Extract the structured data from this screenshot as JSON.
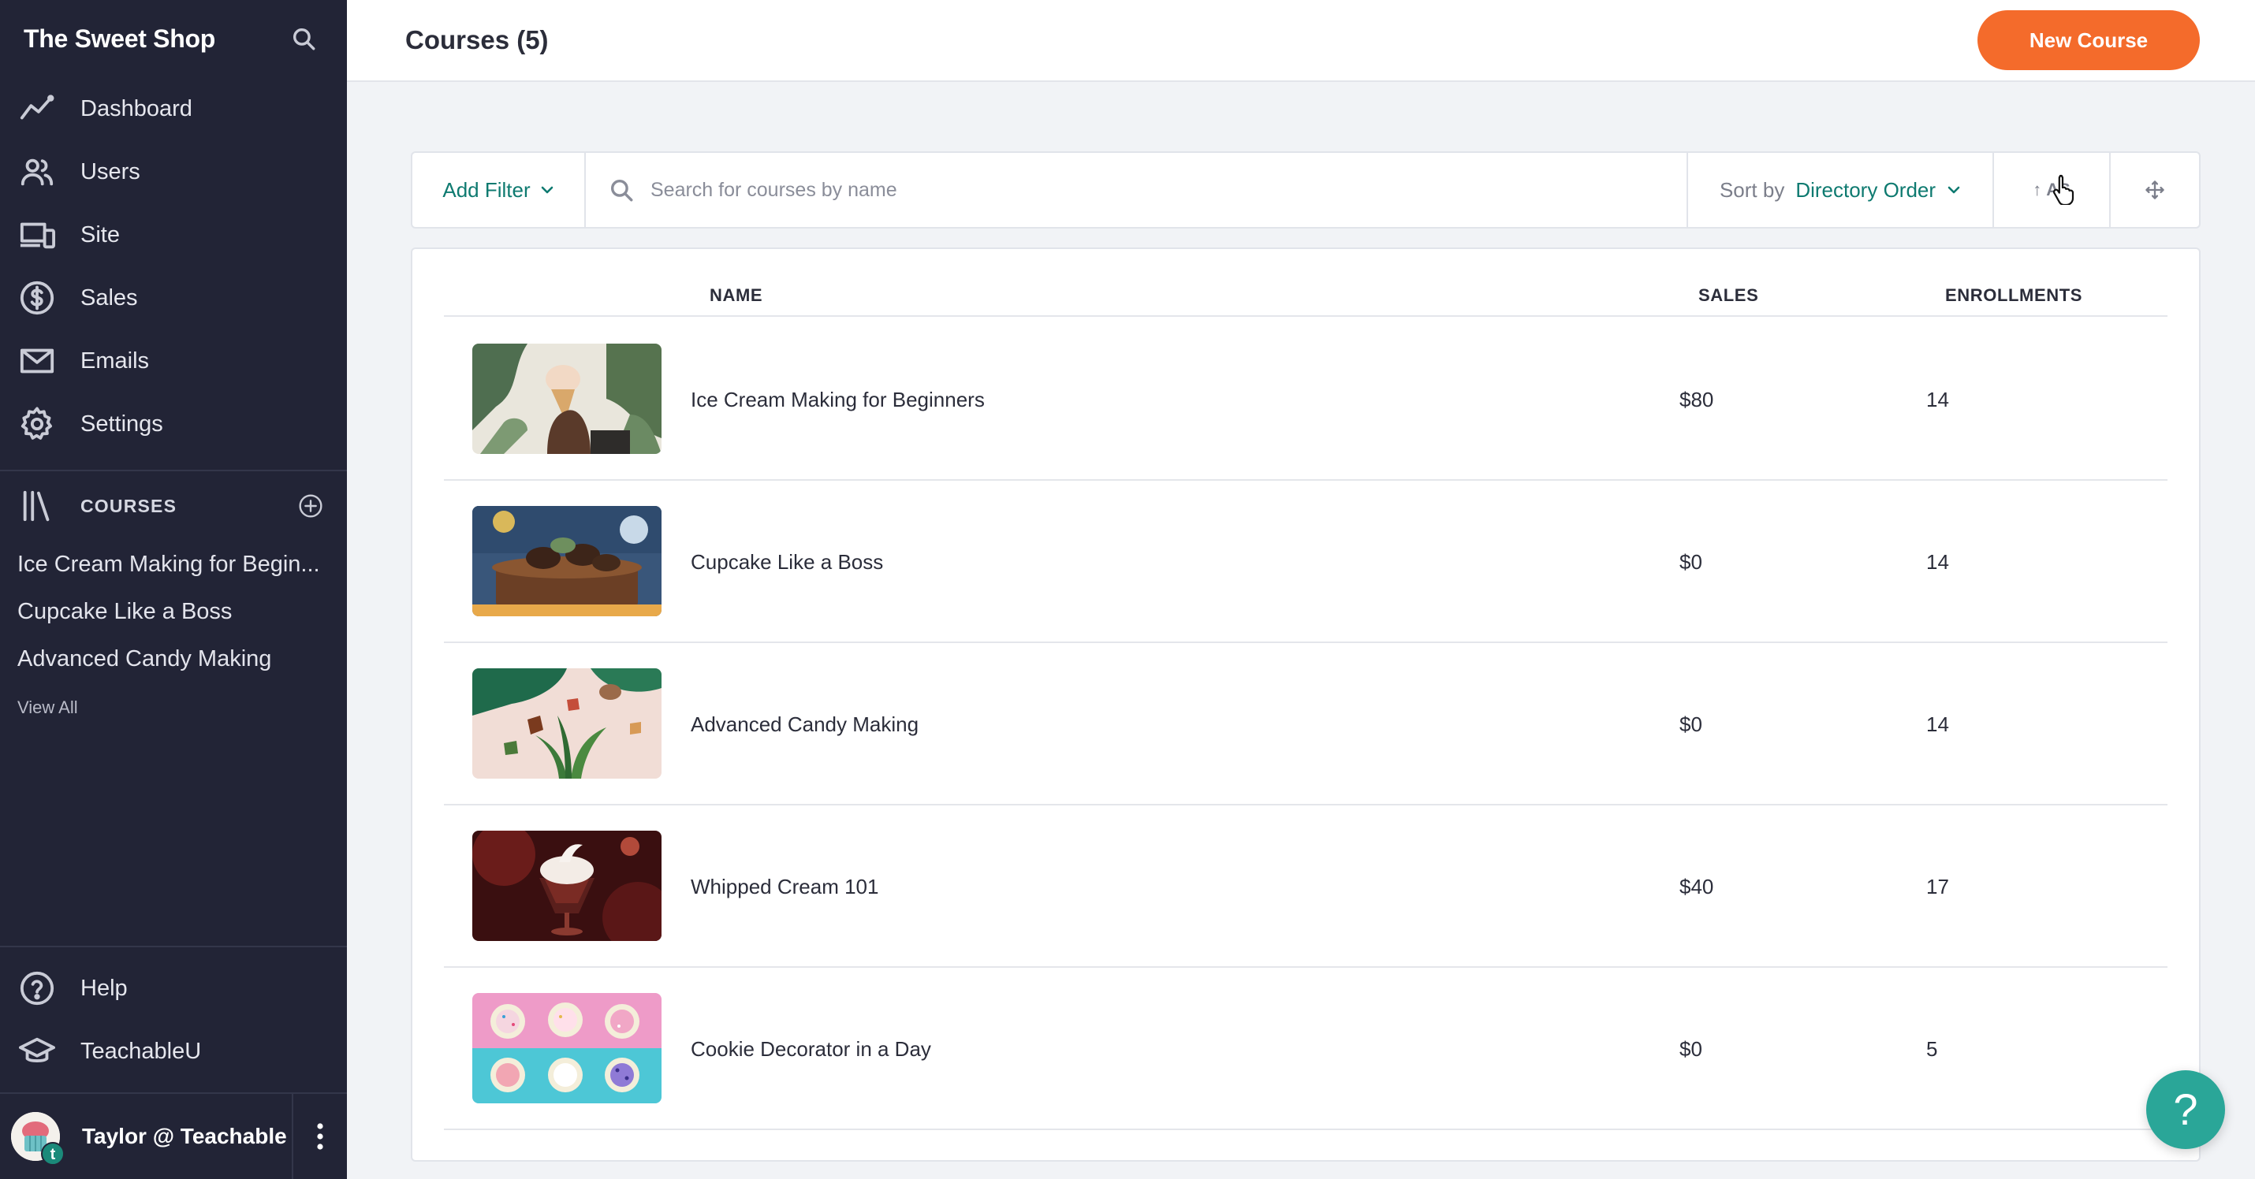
{
  "sidebar": {
    "brand": "The Sweet Shop",
    "nav": [
      {
        "label": "Dashboard",
        "icon": "chart-line-icon"
      },
      {
        "label": "Users",
        "icon": "users-icon"
      },
      {
        "label": "Site",
        "icon": "devices-icon"
      },
      {
        "label": "Sales",
        "icon": "dollar-icon"
      },
      {
        "label": "Emails",
        "icon": "envelope-icon"
      },
      {
        "label": "Settings",
        "icon": "gear-icon"
      }
    ],
    "courses_heading": "COURSES",
    "courses": [
      "Ice Cream Making for Begin...",
      "Cupcake Like a Boss",
      "Advanced Candy Making"
    ],
    "view_all": "View All",
    "help": "Help",
    "teachableu": "TeachableU",
    "user_name": "Taylor @ Teachable",
    "user_badge": "t"
  },
  "header": {
    "title": "Courses (5)",
    "new_button": "New Course"
  },
  "toolbar": {
    "add_filter": "Add Filter",
    "search_placeholder": "Search for courses by name",
    "sort_label": "Sort by",
    "sort_value": "Directory Order",
    "direction": "AS"
  },
  "table": {
    "columns": {
      "name": "NAME",
      "sales": "SALES",
      "enrollments": "ENROLLMENTS"
    },
    "rows": [
      {
        "name": "Ice Cream Making for Beginners",
        "sales": "$80",
        "enrollments": "14"
      },
      {
        "name": "Cupcake Like a Boss",
        "sales": "$0",
        "enrollments": "14"
      },
      {
        "name": "Advanced Candy Making",
        "sales": "$0",
        "enrollments": "14"
      },
      {
        "name": "Whipped Cream 101",
        "sales": "$40",
        "enrollments": "17"
      },
      {
        "name": "Cookie Decorator in a Day",
        "sales": "$0",
        "enrollments": "5"
      }
    ]
  },
  "fab": "?",
  "colors": {
    "sidebar_bg": "#222436",
    "accent_orange": "#f46b2b",
    "accent_teal": "#0e7a70",
    "fab_teal": "#2aa698"
  }
}
